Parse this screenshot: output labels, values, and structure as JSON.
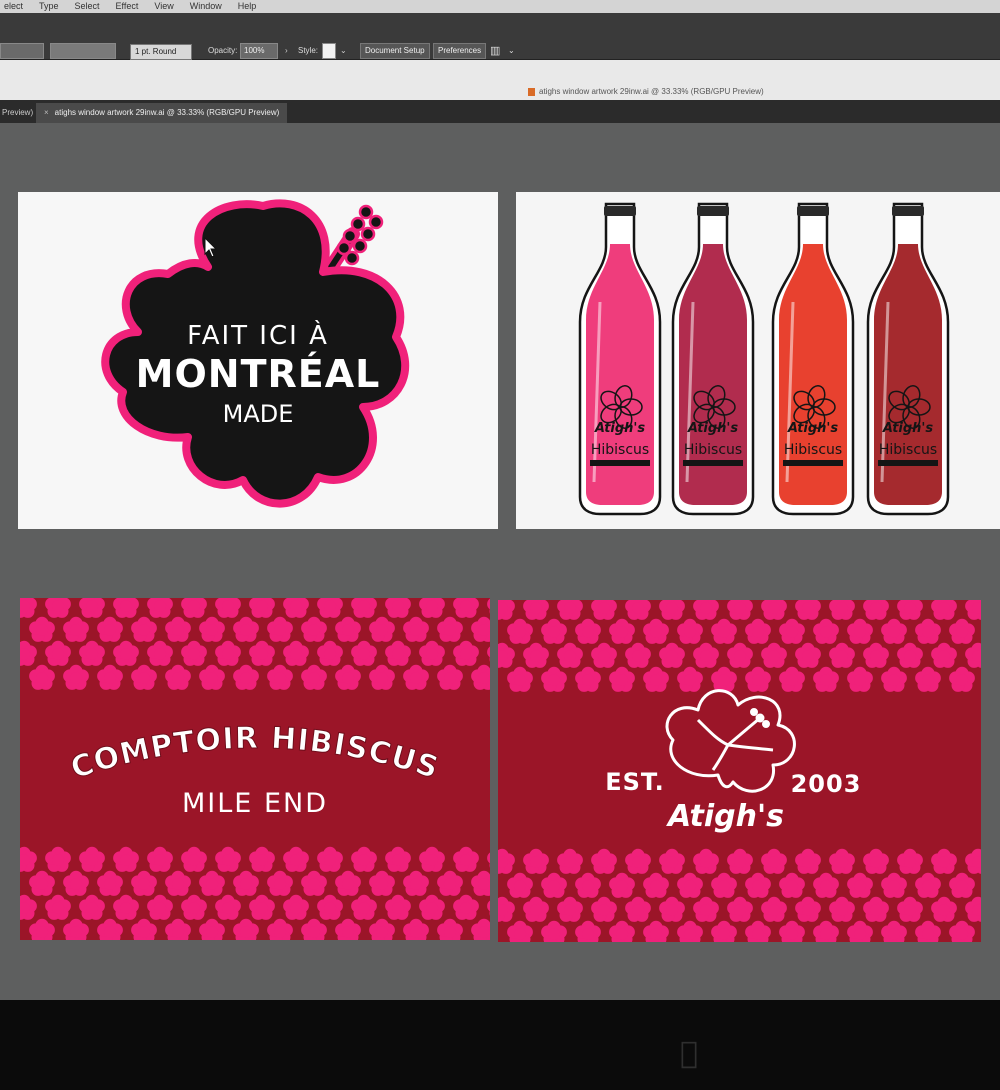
{
  "menubar": {
    "items": [
      "elect",
      "Type",
      "Select",
      "Effect",
      "View",
      "Window",
      "Help"
    ]
  },
  "controlbar": {
    "stroke_weight": "1 pt. Round",
    "opacity_label": "Opacity:",
    "opacity_value": "100%",
    "style_label": "Style:",
    "document_setup": "Document Setup",
    "preferences": "Preferences"
  },
  "window": {
    "title": "atighs window artwork 29inw.ai @ 33.33% (RGB/GPU Preview)"
  },
  "tabs": [
    {
      "label": "Preview)"
    },
    {
      "label": "atighs window artwork 29inw.ai @ 33.33% (RGB/GPU Preview)",
      "close": "×"
    }
  ],
  "artboard1": {
    "line1": "FAIT ICI À",
    "line2": "MONTRÉAL",
    "line3": "MADE"
  },
  "artboard2": {
    "bottles": [
      {
        "brand": "Atigh's",
        "flavor": "Hibiscus",
        "color": "#ef3d7c"
      },
      {
        "brand": "Atigh's",
        "flavor": "Hibiscus",
        "color": "#b12c4e"
      },
      {
        "brand": "Atigh's",
        "flavor": "Hibiscus",
        "color": "#e8412f"
      },
      {
        "brand": "Atigh's",
        "flavor": "Hibiscus",
        "color": "#a52a2e"
      }
    ]
  },
  "artboard3": {
    "line1": "COMPTOIR HIBISCUS",
    "line2": "MILE END"
  },
  "artboard4": {
    "est": "EST.",
    "year": "2003",
    "brand": "Atigh's"
  },
  "colors": {
    "pink": "#f0217a",
    "maroon": "#9b1528",
    "pasteboard": "#5e5f5f",
    "black": "#151515",
    "white": "#ffffff"
  },
  "icons": [
    "selection-cursor-icon",
    "apple-logo-icon",
    "hibiscus-flower-icon",
    "close-tab-icon"
  ]
}
